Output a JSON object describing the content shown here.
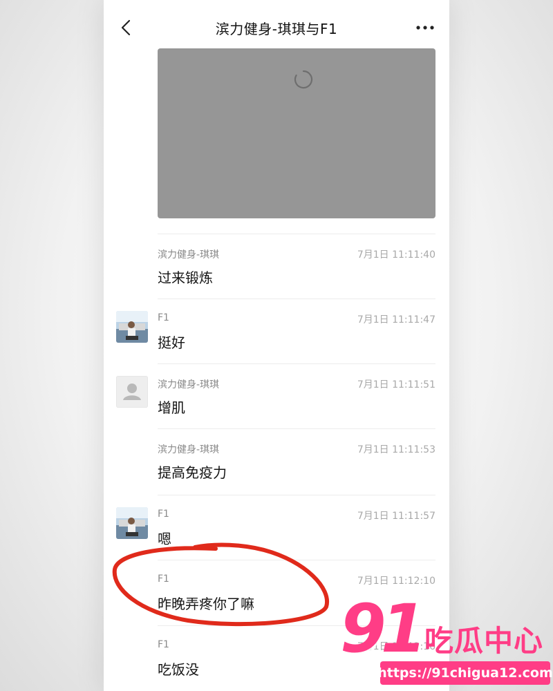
{
  "header": {
    "title": "滨力健身-琪琪与F1"
  },
  "messages": [
    {
      "sender": "滨力健身-琪琪",
      "time": "7月1日 11:11:40",
      "text": "过来锻炼",
      "avatar": "none"
    },
    {
      "sender": "F1",
      "time": "7月1日 11:11:47",
      "text": "挺好",
      "avatar": "photo"
    },
    {
      "sender": "滨力健身-琪琪",
      "time": "7月1日 11:11:51",
      "text": "增肌",
      "avatar": "default"
    },
    {
      "sender": "滨力健身-琪琪",
      "time": "7月1日 11:11:53",
      "text": "提高免疫力",
      "avatar": "none"
    },
    {
      "sender": "F1",
      "time": "7月1日 11:11:57",
      "text": "嗯",
      "avatar": "photo"
    },
    {
      "sender": "F1",
      "time": "7月1日 11:12:10",
      "text": "昨晚弄疼你了嘛",
      "avatar": "none"
    },
    {
      "sender": "F1",
      "time": "7月1日 11:12:16",
      "text": "吃饭没",
      "avatar": "none"
    }
  ],
  "watermark": {
    "number": "91",
    "text": "吃瓜中心",
    "url": "https://91chigua12.com"
  },
  "colors": {
    "accent": "#ff3d86",
    "annotation": "#e02a1b",
    "media_bg": "#969696"
  }
}
